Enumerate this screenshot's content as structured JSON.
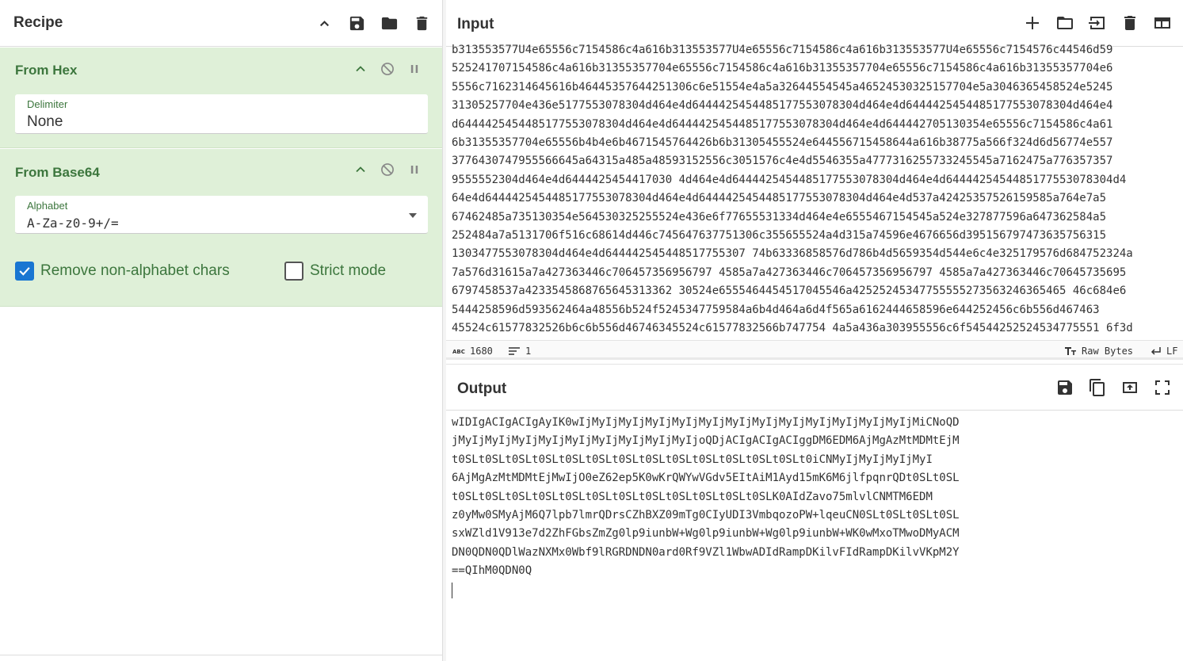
{
  "recipe": {
    "title": "Recipe",
    "operations": [
      {
        "name": "From Hex",
        "arg_label": "Delimiter",
        "arg_value": "None"
      },
      {
        "name": "From Base64",
        "arg_label": "Alphabet",
        "arg_value": "A-Za-z0-9+/=",
        "options": [
          {
            "label": "Remove non-alphabet chars",
            "checked": true
          },
          {
            "label": "Strict mode",
            "checked": false
          }
        ]
      }
    ]
  },
  "input": {
    "title": "Input",
    "text_lines": [
      "b313553577U4e65556c7154586c4a616b313553577U4e65556c7154586c4a616b313553577U4e65556c7154576c44546d59",
      "525241707154586c4a616b31355357704e65556c7154586c4a616b31355357704e65556c7154586c4a616b31355357704e6",
      "5556c7162314645616b46445357644251306c6e51554e4a5a32644554545a46524530325157704e5a3046365458524e5245",
      "31305257704e436e5177553078304d464e4d6444425454485177553078304d464e4d6444425454485177553078304d464e4",
      "d6444425454485177553078304d464e4d6444425454485177553078304d464e4d644442705130354e65556c7154586c4a61",
      "6b31355357704e65556b4b4e6b4671545764426b6b31305455524e644556715458644a616b38775a566f324d6d56774e557",
      "3776430747955566645a64315a485a48593152556c3051576c4e4d5546355a4777316255733245545a7162475a776357357",
      "9555552304d464e4d6444425454417030 4d464e4d6444425454485177553078304d464e4d6444425454485177553078304d4",
      "64e4d6444425454485177553078304d464e4d6444425454485177553078304d464e4d537a42425357526159585a764e7a5",
      "67462485a735130354e564530325255524e436e6f77655531334d464e4e6555467154545a524e327877596a647362584a5",
      "252484a7a5131706f516c68614d446c745647637751306c355655524a4d315a74596e4676656d395156797473635756315",
      "1303477553078304d464e4d644442545448517755307 74b63336858576d786b4d5659354d544e6c4e325179576d684752324a",
      "7a576d31615a7a427363446c706457356956797 4585a7a427363446c706457356956797 4585a7a427363446c70645735695",
      "6797458537a4233545868765645313362 30524e6555464454517045546a42525245347755555273563246365465 46c684e6",
      "5444258596d593562464a48556b524f5245347759584a6b4d464a6d4f565a6162444658596e644252456c6b556d467463",
      "45524c61577832526b6c6b556d46746345524c61577832566b747754 4a5a436a303955556c6f54544252524534775551 6f3d"
    ],
    "line_count_chars": "1680",
    "line_count_lines": "1",
    "encoding": "Raw Bytes",
    "eol": "LF"
  },
  "output": {
    "title": "Output",
    "text_lines": [
      "wIDIgACIgACIgAyIK0wIjMyIjMyIjMyIjMyIjMyIjMyIjMyIjMyIjMyIjMyIjMyIjMyIjMiCNoQD",
      "jMyIjMyIjMyIjMyIjMyIjMyIjMyIjMyIjMyIjoQDjACIgACIgACIggDM6EDM6AjMgAzMtMDMtEjM",
      "t0SLt0SLt0SLt0SLt0SLt0SLt0SLt0SLt0SLt0SLt0SLt0SLt0SLt0iCNMyIjMyIjMyIjMyI",
      "6AjMgAzMtMDMtEjMwIjO0eZ62ep5K0wKrQWYwVGdv5EItAiM1Ayd15mK6M6jlfpqnrQDt0SLt0SL",
      "t0SLt0SLt0SLt0SLt0SLt0SLt0SLt0SLt0SLt0SLt0SLt0SLK0AIdZavo75mlvlCNMTM6EDM",
      "z0yMw0SMyAjM6Q7lpb7lmrQDrsCZhBXZ09mTg0CIyUDI3VmbqozoPW+lqeuCN0SLt0SLt0SLt0SL",
      "sxWZld1V913e7d2ZhFGbsZmZg0lp9iunbW+Wg0lp9iunbW+Wg0lp9iunbW+WK0wMxoTMwoDMyACM",
      "DN0QDN0QDlWazNXMx0Wbf9lRGRDNDN0ard0Rf9VZl1WbwADIdRampDKilvFIdRampDKilvVKpM2Y",
      "==QIhM0QDN0Q"
    ]
  },
  "icons": {
    "recipe_header": [
      "chevron-up-icon",
      "save-icon",
      "folder-icon",
      "trash-icon"
    ],
    "input_header": [
      "plus-icon",
      "folder-icon",
      "import-icon",
      "trash-icon",
      "layout-icon"
    ],
    "output_header": [
      "save-icon",
      "copy-icon",
      "replace-input-icon",
      "maximize-icon"
    ]
  },
  "colors": {
    "op_bg": "#dff0d8",
    "op_text": "#3c763d",
    "checkbox_on": "#1976d2",
    "highlight_f": "#bde6f6",
    "highlight_last": "#fff176"
  }
}
